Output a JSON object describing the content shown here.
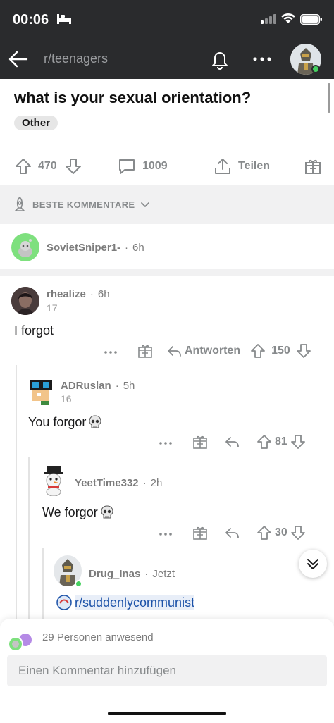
{
  "status": {
    "time": "00:06"
  },
  "header": {
    "subreddit": "r/teenagers"
  },
  "post": {
    "title": "what is your sexual orientation?",
    "flair": "Other",
    "votes": "470",
    "comments": "1009",
    "share_label": "Teilen"
  },
  "sort": {
    "label": "BESTE KOMMENTARE"
  },
  "comments": [
    {
      "user": "SovietSniper1-",
      "age": "6h"
    },
    {
      "user": "rhealize",
      "age": "6h",
      "karma": "17",
      "body": "I forgot",
      "reply_label": "Antworten",
      "votes": "150"
    },
    {
      "user": "ADRuslan",
      "age": "5h",
      "karma": "16",
      "body": "You forgor",
      "votes": "81"
    },
    {
      "user": "YeetTime332",
      "age": "2h",
      "body": "We forgor",
      "votes": "30"
    },
    {
      "user": "Drug_Inas",
      "age": "Jetzt",
      "body": "r/suddenlycommunist"
    }
  ],
  "bottom": {
    "present": "29 Personen anwesend",
    "placeholder": "Einen Kommentar hinzufügen"
  },
  "colors": {
    "header_bg": "#2a2b2d",
    "link": "#1c52a8",
    "online": "#46d160"
  }
}
